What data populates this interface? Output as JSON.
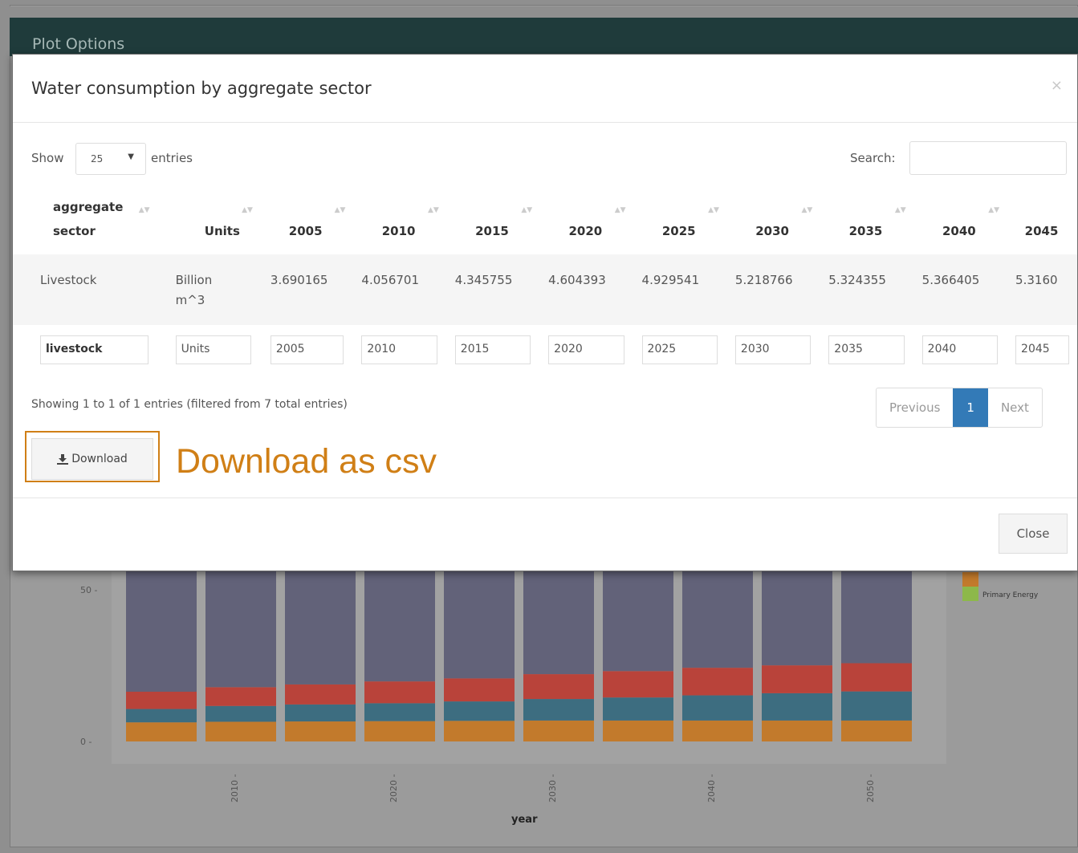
{
  "panel": {
    "title": "Plot Options"
  },
  "modal": {
    "title": "Water consumption by aggregate sector",
    "close_x": "×",
    "length": {
      "show_label": "Show",
      "value": "25",
      "entries_label": "entries"
    },
    "search_label": "Search:",
    "table": {
      "headers": [
        "aggregate sector",
        "Units",
        "2005",
        "2010",
        "2015",
        "2020",
        "2025",
        "2030",
        "2035",
        "2040",
        "2045"
      ],
      "rows": [
        [
          "Livestock",
          "Billion m^3",
          "3.690165",
          "4.056701",
          "4.345755",
          "4.604393",
          "4.929541",
          "5.218766",
          "5.324355",
          "5.366405",
          "5.3160"
        ]
      ],
      "filters": [
        "livestock",
        "Units",
        "2005",
        "2010",
        "2015",
        "2020",
        "2025",
        "2030",
        "2035",
        "2040",
        "2045"
      ]
    },
    "info": "Showing 1 to 1 of 1 entries (filtered from 7 total entries)",
    "pager": {
      "previous": "Previous",
      "current": "1",
      "next": "Next"
    },
    "download_label": "Download",
    "callout": "Download as csv",
    "close_label": "Close"
  },
  "colors": {
    "accent": "#d07f16",
    "primary": "#337ab7",
    "header": "#1f3b3b"
  },
  "chart_data": {
    "type": "bar",
    "stacked": true,
    "xlabel": "year",
    "ylabel": "",
    "x": [
      2005,
      2010,
      2015,
      2020,
      2025,
      2030,
      2035,
      2040,
      2045,
      2050
    ],
    "x_ticks": [
      "2010",
      "2020",
      "2030",
      "2040",
      "2050"
    ],
    "y_ticks": [
      "0",
      "50"
    ],
    "series": [
      {
        "color": "#c27a2c",
        "values": [
          6.3,
          6.5,
          6.6,
          6.7,
          6.8,
          6.9,
          6.9,
          6.9,
          6.9,
          6.9
        ]
      },
      {
        "color": "#3d6d80",
        "values": [
          4.4,
          5.2,
          5.6,
          5.9,
          6.4,
          7.1,
          7.6,
          8.3,
          9.0,
          9.6
        ]
      },
      {
        "color": "#b9433a",
        "values": [
          5.7,
          6.2,
          6.6,
          7.2,
          7.6,
          8.2,
          8.7,
          9.1,
          9.2,
          9.3
        ]
      },
      {
        "color": "#626279",
        "values": [
          78,
          78,
          77,
          77,
          76,
          76,
          75,
          75,
          75,
          74
        ]
      }
    ],
    "legend": {
      "position": "right",
      "items": [
        {
          "name": "Primary Energy",
          "color": "#8db84a"
        }
      ]
    }
  }
}
